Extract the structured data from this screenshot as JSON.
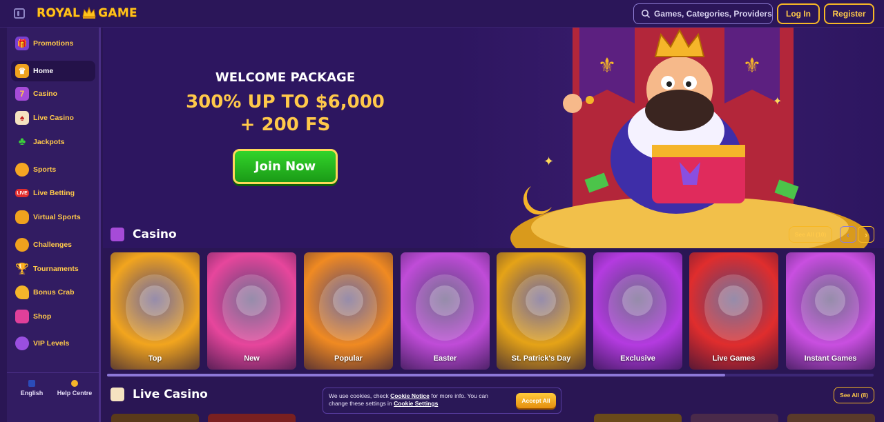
{
  "header": {
    "logo_left": "ROYAL",
    "logo_right": "GAME",
    "search_placeholder": "Games, Categories, Providers",
    "login_label": "Log In",
    "register_label": "Register"
  },
  "sidebar": {
    "items": [
      {
        "label": "Promotions",
        "icon": "gift-icon"
      },
      {
        "label": "Home",
        "icon": "home-crown-icon"
      },
      {
        "label": "Casino",
        "icon": "slot-machine-icon"
      },
      {
        "label": "Live Casino",
        "icon": "playing-cards-icon"
      },
      {
        "label": "Jackpots",
        "icon": "clover-icon"
      },
      {
        "label": "Sports",
        "icon": "ball-icon"
      },
      {
        "label": "Live Betting",
        "icon": "live-badge-icon"
      },
      {
        "label": "Virtual Sports",
        "icon": "gamepad-icon"
      },
      {
        "label": "Challenges",
        "icon": "medal-icon"
      },
      {
        "label": "Tournaments",
        "icon": "trophy-icon"
      },
      {
        "label": "Bonus Crab",
        "icon": "crab-icon"
      },
      {
        "label": "Shop",
        "icon": "shop-icon"
      },
      {
        "label": "VIP Levels",
        "icon": "vip-gem-icon"
      }
    ],
    "language_label": "English",
    "help_label": "Help Centre"
  },
  "hero": {
    "title": "WELCOME PACKAGE",
    "offer_line1": "300% UP TO $6,000",
    "offer_line2": "+ 200 FS",
    "cta_label": "Join Now"
  },
  "casino": {
    "title": "Casino",
    "see_all_label": "See All",
    "count": "(10)",
    "cards": [
      {
        "label": "Top",
        "color": "#f2a51e"
      },
      {
        "label": "New",
        "color": "#e7469c"
      },
      {
        "label": "Popular",
        "color": "#f08a22"
      },
      {
        "label": "Easter",
        "color": "#c04cd8"
      },
      {
        "label": "St. Patrick's Day",
        "color": "#e5a317"
      },
      {
        "label": "Exclusive",
        "color": "#b43be0"
      },
      {
        "label": "Live Games",
        "color": "#e02d2d"
      },
      {
        "label": "Instant Games",
        "color": "#c94fe0"
      }
    ]
  },
  "live_casino": {
    "title": "Live Casino",
    "see_all_label": "See All",
    "count": "(8)"
  },
  "cookie": {
    "text_1": "We use cookies, check",
    "link_notice": "Cookie Notice",
    "text_2": "for more info. You can",
    "text_3": "change these settings in",
    "link_settings": "Cookie Settings",
    "accept_label": "Accept All"
  },
  "colors": {
    "accent": "#ffc94a",
    "background": "#2a1654",
    "cta_green": "#2bbf23"
  }
}
